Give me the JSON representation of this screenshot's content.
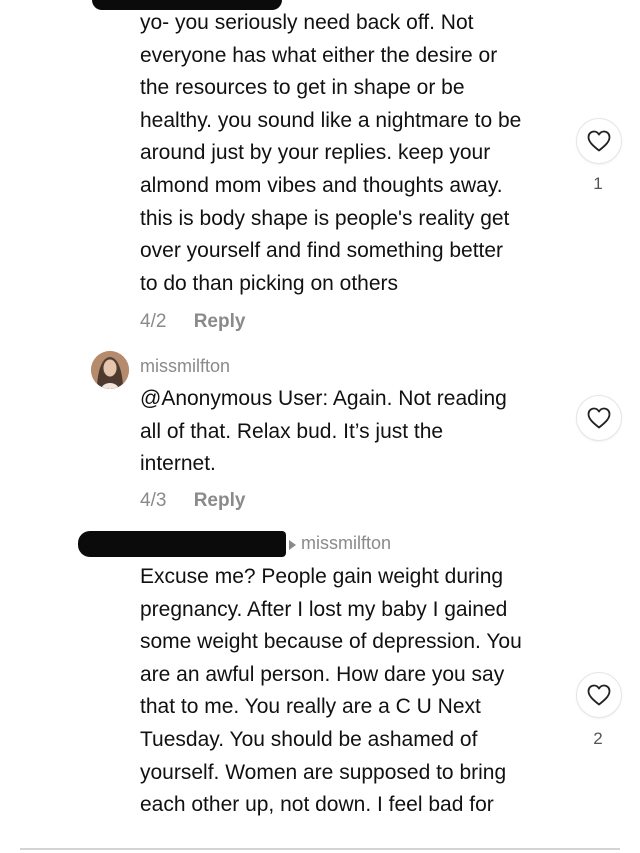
{
  "comment1": {
    "text": "yo- you seriously need back off. Not\neveryone has what either the desire or\nthe resources to get in shape or be\nhealthy. you sound like a nightmare to be\naround just by your replies. keep your\nalmond mom vibes and thoughts away.\nthis is body shape is people's reality get\nover yourself and find something better\nto do than picking on others",
    "date": "4/2",
    "reply_label": "Reply",
    "like_count": "1",
    "like_icon": "heart-outline"
  },
  "comment2": {
    "username": "missmilfton",
    "text": "@Anonymous User: Again. Not reading\nall of that. Relax bud. It’s just the\ninternet.",
    "date": "4/3",
    "reply_label": "Reply",
    "like_icon": "heart-outline"
  },
  "comment3": {
    "reply_to": "missmilfton",
    "text": "Excuse me? People gain weight during\npregnancy. After I lost my baby I gained\nsome weight because of depression. You\nare an awful person. How dare you say\nthat to me. You really are a C U Next\nTuesday. You should be ashamed of\nyourself. Women are supposed to bring\neach other up, not down. I feel bad for",
    "like_count": "2",
    "like_icon": "heart-outline"
  }
}
